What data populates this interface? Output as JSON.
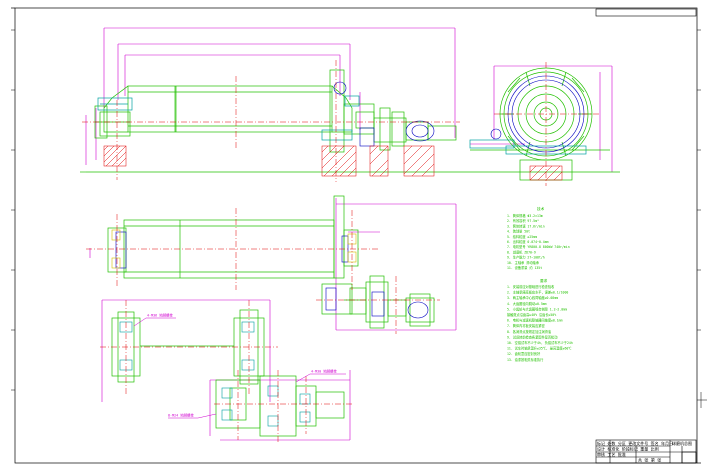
{
  "drawing": {
    "top_corner_code": "",
    "notes_block_1_title": "技术",
    "notes_block_1": [
      "1. 筒体规格 Φ3.2×13m",
      "2. 有效容积 97.5m³",
      "3. 筒体转速 17.6r/min",
      "4. 装球量 50t",
      "5. 给料粒度 ≤25mm",
      "6. 出料粒度 0.074~0.4mm",
      "7. 电机型号 YR800-8  800kW  740r/min",
      "8. 减速机 ZD70-9",
      "9. 生产能力 27~108t/h",
      "10. 主轴承 滑动轴承",
      "11. 设备重量 约 135t"
    ],
    "notes_block_2_title": "要求",
    "notes_block_2": [
      "1. 安装前应对基础进行检查验收",
      "2. 主轴承座底板应水平，误差≤0.1/1000",
      "3. 两主轴承中心线同轴度≤0.08mm",
      "4. 大齿圈径向跳动≤0.5mm",
      "5. 小齿轮与大齿圈啮合侧隙 1.2~2.0mm",
      "   接触斑点沿齿高≥40% 沿齿长≥50%",
      "6. 电机与减速机联轴器同轴度≤0.1mm",
      "7. 筒体内衬板安装应紧密",
      "8. 各润滑点按规定加注润滑油",
      "9. 试运转前检查各紧固件是否松动",
      "10. 空载试车不少于4h, 负载试车不少于24h",
      "11. 试车时轴承温升≤35℃, 最高温度≤60℃",
      "12. 齿轮罩应密封良好",
      "13. 油漆按相关标准执行"
    ],
    "foundation_tags": [
      "4-M36 地脚螺栓",
      "4-M30 地脚螺栓",
      "8-M24 地脚螺栓"
    ],
    "title_block": {
      "rows": [
        "标记 处数 分区 更改文件号 签名 年月日",
        "设计 标准化 阶段标记 重量 比例",
        "审核 工艺 批准"
      ],
      "name": "球磨机总图",
      "drawing_no": "",
      "sheet": "共 张 第 张",
      "company": ""
    },
    "colors": {
      "outline": "#22c000",
      "dimension": "#d000d0",
      "centerline": "#e00000",
      "pedestal": "#00a0a0",
      "hatch": "#e00000",
      "gear": "#0000c0",
      "frame": "#000000"
    }
  }
}
